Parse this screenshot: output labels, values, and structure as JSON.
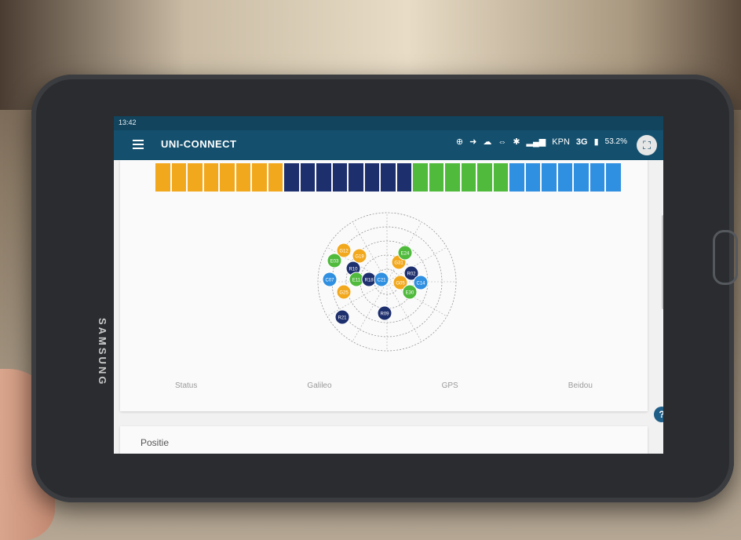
{
  "device": {
    "brand": "SAMSUNG"
  },
  "statusbar": {
    "time": "13:42"
  },
  "appbar": {
    "title": "UNI-CONNECT",
    "icons": [
      "gps-icon",
      "arrow-icon",
      "cloud-icon",
      "link-icon",
      "bluetooth-icon",
      "signal-icon"
    ],
    "network": "KPN",
    "network_type": "3G",
    "battery": "53.2%"
  },
  "chart": {
    "colors": {
      "gps": "#f2a81d",
      "glonass": "#1e2f6e",
      "galileo": "#4fba3c",
      "beidou": "#2f8fe0"
    },
    "groups": [
      {
        "name": "gps",
        "count": 8
      },
      {
        "name": "glonass",
        "count": 8
      },
      {
        "name": "galileo",
        "count": 6
      },
      {
        "name": "beidou",
        "count": 7
      }
    ]
  },
  "sky": {
    "satellites": [
      {
        "label": "G12",
        "group": "gps"
      },
      {
        "label": "E03",
        "group": "galileo"
      },
      {
        "label": "R10",
        "group": "glonass"
      },
      {
        "label": "C07",
        "group": "beidou"
      },
      {
        "label": "G25",
        "group": "gps"
      },
      {
        "label": "E11",
        "group": "galileo"
      },
      {
        "label": "R18",
        "group": "glonass"
      },
      {
        "label": "C21",
        "group": "beidou"
      },
      {
        "label": "G31",
        "group": "gps"
      },
      {
        "label": "E24",
        "group": "galileo"
      },
      {
        "label": "R02",
        "group": "glonass"
      },
      {
        "label": "C14",
        "group": "beidou"
      },
      {
        "label": "G05",
        "group": "gps"
      },
      {
        "label": "E30",
        "group": "galileo"
      },
      {
        "label": "R21",
        "group": "glonass"
      },
      {
        "label": "R09",
        "group": "glonass"
      },
      {
        "label": "G19",
        "group": "gps"
      }
    ]
  },
  "tabs": [
    "Status",
    "Galileo",
    "GPS",
    "Beidou"
  ],
  "help": "?",
  "positie": "Positie"
}
